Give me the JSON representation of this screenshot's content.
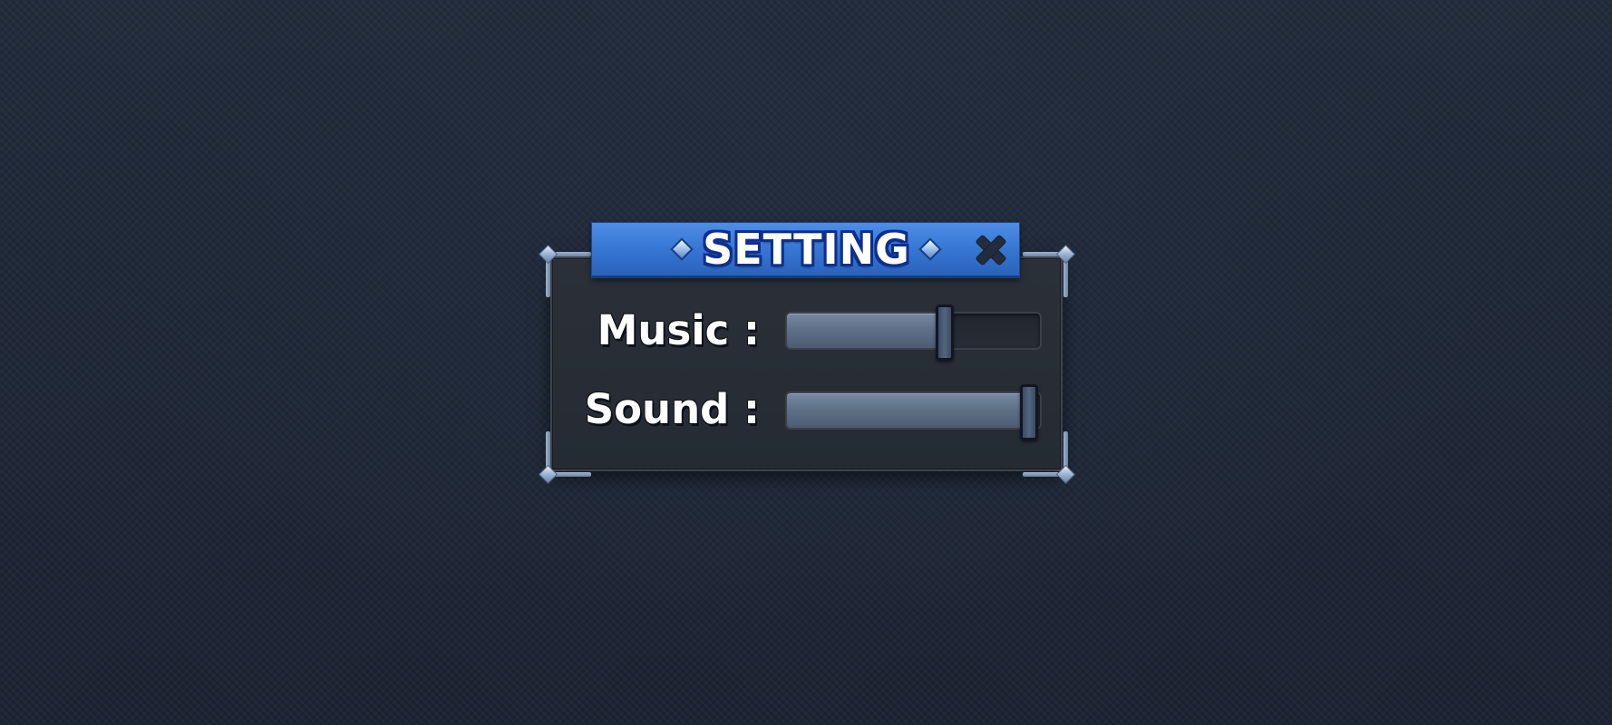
{
  "dialog": {
    "title": "SETTING",
    "close_icon": "close-icon"
  },
  "settings": [
    {
      "id": "music",
      "label": "Music :",
      "level": 0.64
    },
    {
      "id": "sound",
      "label": "Sound :",
      "level": 1.0
    }
  ],
  "colors": {
    "background": "#1b2230",
    "panel": "#282d35",
    "banner": "#3777d4",
    "title_outline": "#0e2f8f",
    "slider_fill": "#5d6e86",
    "handle": "#101722"
  }
}
